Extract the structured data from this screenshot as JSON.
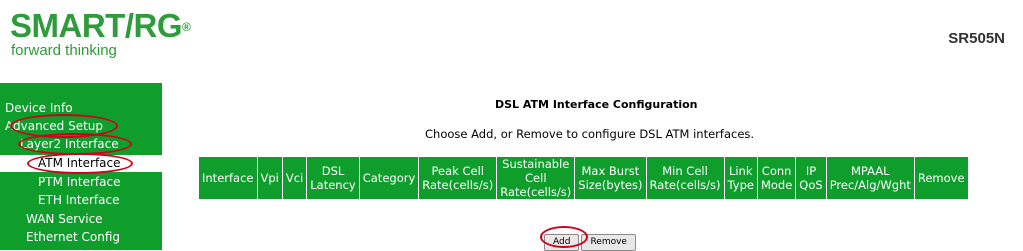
{
  "brand": {
    "name_left": "SMART",
    "slash": "/",
    "name_right": "RG",
    "registered": "®",
    "tagline": "forward thinking"
  },
  "model": "SR505N",
  "sidebar": {
    "items": [
      {
        "label": "Device Info"
      },
      {
        "label": "Advanced Setup"
      },
      {
        "label": "Layer2 Interface"
      },
      {
        "label": "ATM Interface"
      },
      {
        "label": "PTM Interface"
      },
      {
        "label": "ETH Interface"
      },
      {
        "label": "WAN Service"
      },
      {
        "label": "Ethernet Config"
      }
    ]
  },
  "main": {
    "title": "DSL ATM Interface Configuration",
    "instructions": "Choose Add, or Remove to configure DSL ATM interfaces.",
    "table": {
      "headers": [
        [
          "Interface"
        ],
        [
          "Vpi"
        ],
        [
          "Vci"
        ],
        [
          "DSL",
          "Latency"
        ],
        [
          "Category"
        ],
        [
          "Peak Cell",
          "Rate(cells/s)"
        ],
        [
          "Sustainable",
          "Cell",
          "Rate(cells/s)"
        ],
        [
          "Max Burst",
          "Size(bytes)"
        ],
        [
          "Min Cell",
          "Rate(cells/s)"
        ],
        [
          "Link",
          "Type"
        ],
        [
          "Conn",
          "Mode"
        ],
        [
          "IP",
          "QoS"
        ],
        [
          "MPAAL",
          "Prec/Alg/Wght"
        ],
        [
          "Remove"
        ]
      ],
      "rows": []
    },
    "buttons": {
      "add": "Add",
      "remove": "Remove"
    }
  },
  "colors": {
    "brand_green": "#2e9b3c",
    "nav_green": "#0f9e2c",
    "highlight_red": "#d0021b"
  }
}
